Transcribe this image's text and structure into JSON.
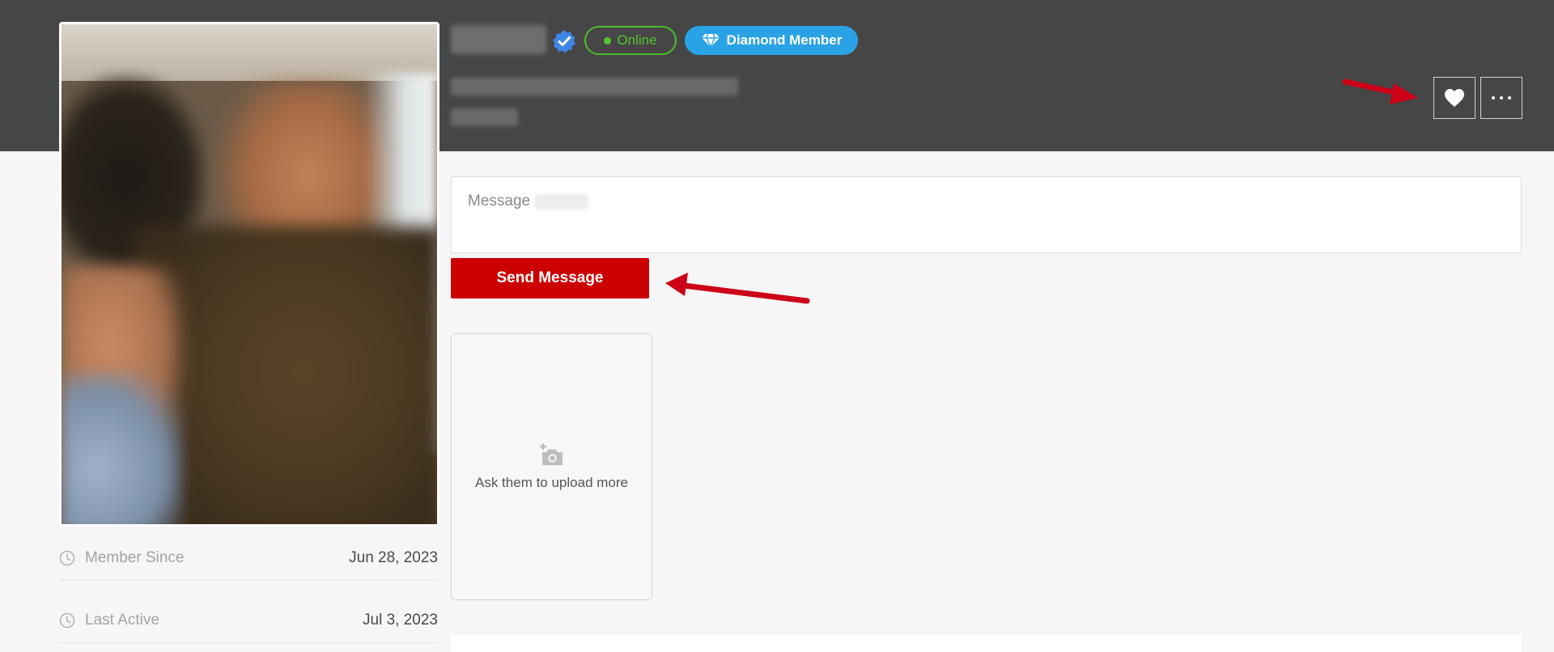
{
  "profile": {
    "photo_icon": "profile-photo",
    "verified_icon": "verified-check-icon",
    "status_badge": "Online",
    "membership_badge": "Diamond Member",
    "membership_icon": "diamond-icon"
  },
  "actions": {
    "favorite_icon": "heart-icon",
    "more_icon": "more-options-icon"
  },
  "message": {
    "placeholder": "Message",
    "send_label": "Send Message"
  },
  "gallery": {
    "upload_prompt": "Ask them to upload more",
    "icon": "add-camera-icon"
  },
  "stats": [
    {
      "label": "Member Since",
      "value": "Jun 28, 2023",
      "icon": "clock-icon"
    },
    {
      "label": "Last Active",
      "value": "Jul 3, 2023",
      "icon": "clock-icon"
    }
  ],
  "colors": {
    "header_bg": "#464646",
    "page_bg": "#f6f6f6",
    "online_green": "#55c52e",
    "diamond_blue": "#2aa3e6",
    "send_red": "#cc0000",
    "arrow_red": "#cc0018"
  }
}
